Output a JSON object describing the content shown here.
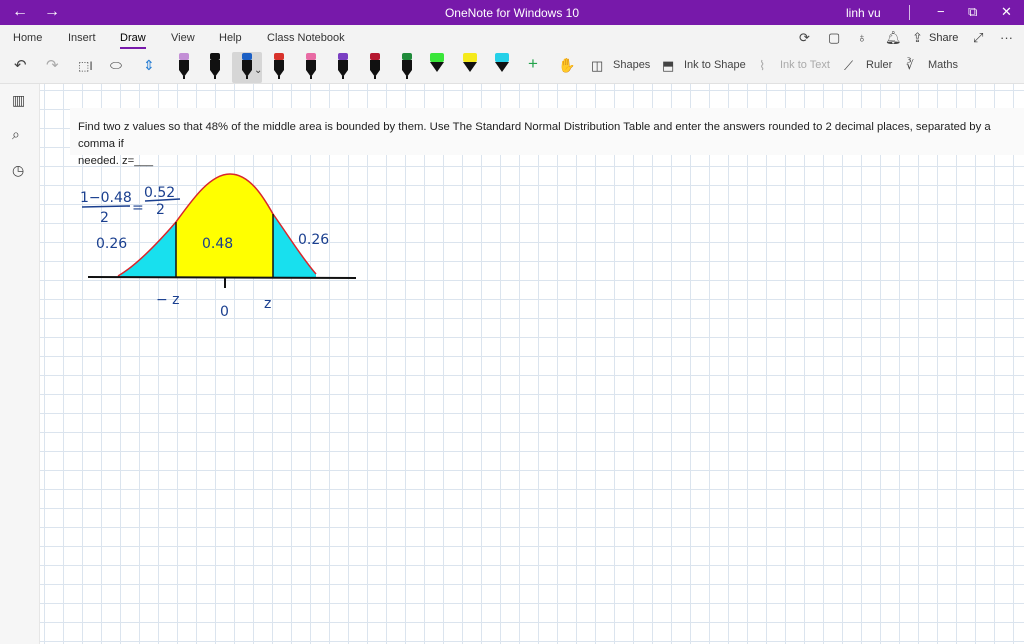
{
  "titlebar": {
    "back": "←",
    "forward": "→",
    "title": "OneNote for Windows 10",
    "user": "linh vu",
    "minimize": "−",
    "restore": "⧉",
    "close": "✕"
  },
  "menu": {
    "tabs": [
      "Home",
      "Insert",
      "Draw",
      "View",
      "Help",
      "Class Notebook"
    ],
    "active_tab": "Draw",
    "share_label": "Share",
    "more": "···"
  },
  "toolbar": {
    "shapes_label": "Shapes",
    "ink_to_shape_label": "Ink to Shape",
    "ink_to_text_label": "Ink to Text",
    "ruler_label": "Ruler",
    "maths_label": "Maths",
    "add": "+",
    "pens": [
      {
        "color": "#c38fd6"
      },
      {
        "color": "#111111"
      },
      {
        "color": "#1b5fc4"
      },
      {
        "color": "#d8322b"
      },
      {
        "color": "#e86ba4"
      },
      {
        "color": "#7a3fc2"
      },
      {
        "color": "#b5172f"
      },
      {
        "color": "#1f8a3a"
      }
    ],
    "highlighters": [
      {
        "color": "#39e639"
      },
      {
        "color": "#f5ea1c"
      },
      {
        "color": "#25d0e8"
      }
    ]
  },
  "question": {
    "line1": "Find two z values so that 48% of the middle area is bounded by them. Use The Standard Normal Distribution Table and enter the answers rounded to 2 decimal places, separated by a comma if",
    "line2": "needed. z=___"
  },
  "sketch": {
    "formula_top_left": "1−0.48",
    "formula_den_left": "2",
    "formula_eq": "=",
    "formula_top_right": "0.52",
    "formula_den_right": "2",
    "left_tail": "0.26",
    "middle": "0.48",
    "right_tail": "0.26",
    "neg_z": "− z",
    "zero": "0",
    "pos_z": "z",
    "colors": {
      "curve": "#d9262b",
      "middle_fill": "#ffff00",
      "tail_fill": "#18e0ee",
      "ink": "#1a3f8f",
      "axis": "#111111"
    }
  }
}
